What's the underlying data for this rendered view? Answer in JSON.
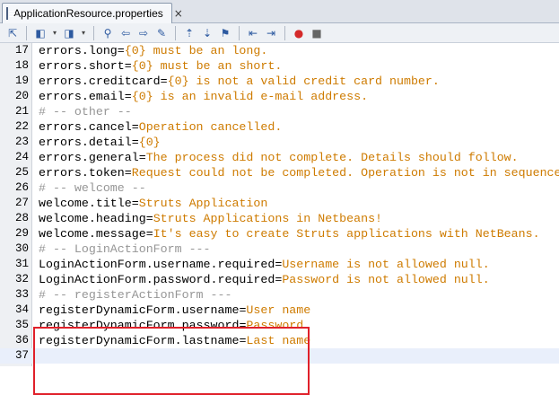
{
  "tab": {
    "title": "ApplicationResource.properties",
    "close_label": "×",
    "icon": "properties-file-icon"
  },
  "toolbar": {
    "icons": [
      "last-edit-icon",
      "back-icon",
      "forward-icon",
      "find-icon",
      "find-previous-icon",
      "find-next-icon",
      "toggle-highlight-icon",
      "previous-bookmark-icon",
      "next-bookmark-icon",
      "toggle-bookmark-icon",
      "shift-left-icon",
      "shift-right-icon",
      "start-macro-icon",
      "stop-macro-icon"
    ]
  },
  "editor": {
    "lines": [
      {
        "num": "17",
        "key": "errors.long",
        "eq": "=",
        "val": "{0} must be an long.",
        "comment": ""
      },
      {
        "num": "18",
        "key": "errors.short",
        "eq": "=",
        "val": "{0} must be an short.",
        "comment": ""
      },
      {
        "num": "19",
        "key": "errors.creditcard",
        "eq": "=",
        "val": "{0} is not a valid credit card number.",
        "comment": ""
      },
      {
        "num": "20",
        "key": "errors.email",
        "eq": "=",
        "val": "{0} is an invalid e-mail address.",
        "comment": ""
      },
      {
        "num": "21",
        "key": "",
        "eq": "",
        "val": "",
        "comment": "# -- other --"
      },
      {
        "num": "22",
        "key": "errors.cancel",
        "eq": "=",
        "val": "Operation cancelled.",
        "comment": ""
      },
      {
        "num": "23",
        "key": "errors.detail",
        "eq": "=",
        "val": "{0}",
        "comment": ""
      },
      {
        "num": "24",
        "key": "errors.general",
        "eq": "=",
        "val": "The process did not complete. Details should follow.",
        "comment": ""
      },
      {
        "num": "25",
        "key": "errors.token",
        "eq": "=",
        "val": "Request could not be completed. Operation is not in sequence.",
        "comment": ""
      },
      {
        "num": "26",
        "key": "",
        "eq": "",
        "val": "",
        "comment": "# -- welcome --"
      },
      {
        "num": "27",
        "key": "welcome.title",
        "eq": "=",
        "val": "Struts Application",
        "comment": ""
      },
      {
        "num": "28",
        "key": "welcome.heading",
        "eq": "=",
        "val": "Struts Applications in Netbeans!",
        "comment": ""
      },
      {
        "num": "29",
        "key": "welcome.message",
        "eq": "=",
        "val": "It's easy to create Struts applications with NetBeans.",
        "comment": ""
      },
      {
        "num": "30",
        "key": "",
        "eq": "",
        "val": "",
        "comment": "# -- LoginActionForm ---"
      },
      {
        "num": "31",
        "key": "LoginActionForm.username.required",
        "eq": "=",
        "val": "Username is not allowed null.",
        "comment": ""
      },
      {
        "num": "32",
        "key": "LoginActionForm.password.required",
        "eq": "=",
        "val": "Password is not allowed null.",
        "comment": ""
      },
      {
        "num": "33",
        "key": "",
        "eq": "",
        "val": "",
        "comment": "# -- registerActionForm ---"
      },
      {
        "num": "34",
        "key": "registerDynamicForm.username",
        "eq": "=",
        "val": "User name",
        "comment": ""
      },
      {
        "num": "35",
        "key": "registerDynamicForm.password",
        "eq": "=",
        "val": "Password",
        "comment": ""
      },
      {
        "num": "36",
        "key": "registerDynamicForm.lastname",
        "eq": "=",
        "val": "Last name",
        "comment": ""
      },
      {
        "num": "37",
        "key": "",
        "eq": "",
        "val": "",
        "comment": ""
      }
    ],
    "current_line": "37"
  },
  "colors": {
    "value": "#ce7b00",
    "comment": "#969696",
    "highlight_box": "#e0202a"
  }
}
